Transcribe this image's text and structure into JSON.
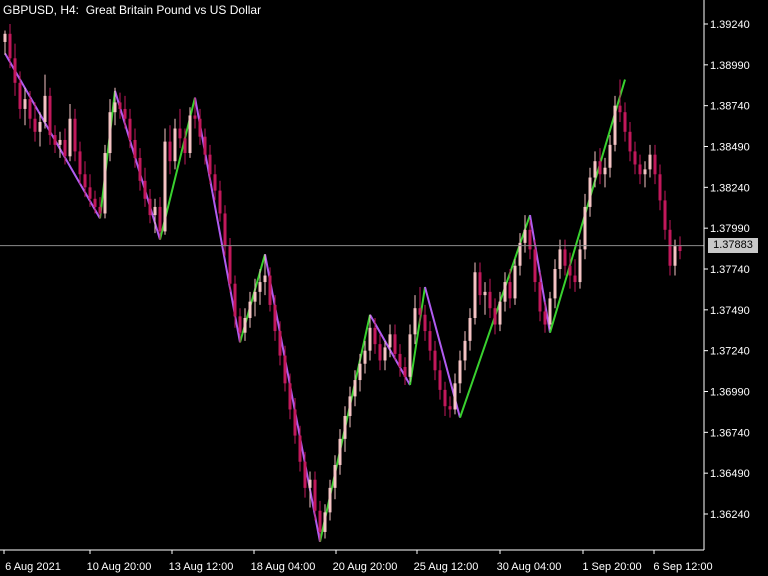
{
  "header": {
    "symbol_line": "GBPUSD, H4:  Great Britain Pound vs US Dollar"
  },
  "current_price": {
    "label": "1.37883",
    "value": 1.37883
  },
  "colors": {
    "background": "#000000",
    "bull_candle": "#f4c3c4",
    "bear_candle": "#c2185b",
    "zigzag_up": "#39d12f",
    "zigzag_down": "#b05cf0",
    "axis": "#ffffff",
    "price_line": "#8c8c8c",
    "price_tag_bg": "#c8c8c8"
  },
  "chart_data": {
    "type": "candlestick",
    "title": "GBPUSD, H4:  Great Britain Pound vs US Dollar",
    "ylim": [
      1.36,
      1.3945
    ],
    "y_ticks": [
      1.3624,
      1.3649,
      1.3674,
      1.3699,
      1.3724,
      1.3749,
      1.3774,
      1.3799,
      1.3824,
      1.3849,
      1.3874,
      1.3899,
      1.3924
    ],
    "y_tick_labels": [
      "1.36240",
      "1.36490",
      "1.36740",
      "1.36990",
      "1.37240",
      "1.37490",
      "1.37740",
      "1.37990",
      "1.38240",
      "1.38490",
      "1.38740",
      "1.38990",
      "1.39240"
    ],
    "x_tick_labels": [
      "6 Aug 2021",
      "10 Aug 20:00",
      "13 Aug 12:00",
      "18 Aug 04:00",
      "20 Aug 20:00",
      "25 Aug 12:00",
      "30 Aug 04:00",
      "1 Sep 20:00",
      "6 Sep 12:00"
    ],
    "candle_count": 138,
    "zigzag": [
      {
        "bar": 0,
        "price": 1.3906
      },
      {
        "bar": 19,
        "price": 1.3805
      },
      {
        "bar": 22,
        "price": 1.3883
      },
      {
        "bar": 31,
        "price": 1.3792
      },
      {
        "bar": 38,
        "price": 1.3879
      },
      {
        "bar": 47,
        "price": 1.3729
      },
      {
        "bar": 52,
        "price": 1.3783
      },
      {
        "bar": 63,
        "price": 1.3607
      },
      {
        "bar": 73,
        "price": 1.3746
      },
      {
        "bar": 81,
        "price": 1.3703
      },
      {
        "bar": 84,
        "price": 1.3763
      },
      {
        "bar": 91,
        "price": 1.3683
      },
      {
        "bar": 105,
        "price": 1.3807
      },
      {
        "bar": 109,
        "price": 1.3735
      },
      {
        "bar": 124,
        "price": 1.389
      }
    ],
    "candles": [
      [
        1.3913,
        1.392,
        1.3905,
        1.3918
      ],
      [
        1.3918,
        1.3924,
        1.3897,
        1.3903
      ],
      [
        1.3903,
        1.3912,
        1.388,
        1.3888
      ],
      [
        1.3888,
        1.3895,
        1.3866,
        1.3872
      ],
      [
        1.3872,
        1.3885,
        1.3862,
        1.3878
      ],
      [
        1.3878,
        1.3883,
        1.386,
        1.3866
      ],
      [
        1.3866,
        1.3876,
        1.3852,
        1.3858
      ],
      [
        1.3858,
        1.387,
        1.3849,
        1.3864
      ],
      [
        1.3864,
        1.3893,
        1.386,
        1.388
      ],
      [
        1.388,
        1.3885,
        1.385,
        1.3856
      ],
      [
        1.3856,
        1.3862,
        1.3845,
        1.385
      ],
      [
        1.385,
        1.3858,
        1.3842,
        1.3853
      ],
      [
        1.3853,
        1.386,
        1.3838,
        1.3843
      ],
      [
        1.3843,
        1.3875,
        1.384,
        1.3866
      ],
      [
        1.3866,
        1.3872,
        1.384,
        1.3846
      ],
      [
        1.3846,
        1.3852,
        1.3826,
        1.3832
      ],
      [
        1.3832,
        1.384,
        1.3818,
        1.3824
      ],
      [
        1.3824,
        1.3832,
        1.3812,
        1.3817
      ],
      [
        1.3817,
        1.3822,
        1.3808,
        1.3812
      ],
      [
        1.3812,
        1.3818,
        1.3805,
        1.3808
      ],
      [
        1.3808,
        1.385,
        1.3805,
        1.3845
      ],
      [
        1.3845,
        1.3878,
        1.384,
        1.387
      ],
      [
        1.387,
        1.3885,
        1.3862,
        1.3876
      ],
      [
        1.3876,
        1.3882,
        1.3866,
        1.3872
      ],
      [
        1.3872,
        1.388,
        1.386,
        1.3866
      ],
      [
        1.3866,
        1.3872,
        1.3848,
        1.3853
      ],
      [
        1.3853,
        1.386,
        1.3836,
        1.3842
      ],
      [
        1.3842,
        1.3848,
        1.3822,
        1.3828
      ],
      [
        1.3828,
        1.3836,
        1.3812,
        1.3817
      ],
      [
        1.3817,
        1.3823,
        1.3802,
        1.3807
      ],
      [
        1.3807,
        1.3817,
        1.3796,
        1.3812
      ],
      [
        1.3812,
        1.3818,
        1.3792,
        1.3797
      ],
      [
        1.3797,
        1.386,
        1.3795,
        1.3852
      ],
      [
        1.3852,
        1.3862,
        1.3832,
        1.384
      ],
      [
        1.384,
        1.3866,
        1.3835,
        1.386
      ],
      [
        1.386,
        1.3872,
        1.3848,
        1.3854
      ],
      [
        1.3854,
        1.386,
        1.3838,
        1.3845
      ],
      [
        1.3845,
        1.3873,
        1.3842,
        1.3868
      ],
      [
        1.3868,
        1.3879,
        1.386,
        1.3866
      ],
      [
        1.3866,
        1.3872,
        1.385,
        1.3855
      ],
      [
        1.3855,
        1.386,
        1.3838,
        1.3844
      ],
      [
        1.3844,
        1.385,
        1.3826,
        1.3832
      ],
      [
        1.3832,
        1.3838,
        1.3816,
        1.3822
      ],
      [
        1.3822,
        1.3828,
        1.3803,
        1.3808
      ],
      [
        1.3808,
        1.3813,
        1.3782,
        1.3788
      ],
      [
        1.3788,
        1.3793,
        1.376,
        1.3765
      ],
      [
        1.3765,
        1.377,
        1.3738,
        1.3745
      ],
      [
        1.3745,
        1.375,
        1.3729,
        1.3735
      ],
      [
        1.3735,
        1.375,
        1.373,
        1.3744
      ],
      [
        1.3744,
        1.376,
        1.3738,
        1.3754
      ],
      [
        1.3754,
        1.3768,
        1.3745,
        1.376
      ],
      [
        1.376,
        1.3774,
        1.3752,
        1.3766
      ],
      [
        1.3766,
        1.3783,
        1.3758,
        1.377
      ],
      [
        1.377,
        1.3775,
        1.3748,
        1.3752
      ],
      [
        1.3752,
        1.3758,
        1.373,
        1.3736
      ],
      [
        1.3736,
        1.3742,
        1.3715,
        1.3721
      ],
      [
        1.3721,
        1.3727,
        1.3699,
        1.3704
      ],
      [
        1.3704,
        1.371,
        1.3682,
        1.3688
      ],
      [
        1.3688,
        1.3695,
        1.3667,
        1.3672
      ],
      [
        1.3672,
        1.3678,
        1.365,
        1.3656
      ],
      [
        1.3656,
        1.3662,
        1.3634,
        1.364
      ],
      [
        1.364,
        1.365,
        1.3628,
        1.3645
      ],
      [
        1.3645,
        1.365,
        1.362,
        1.3626
      ],
      [
        1.3626,
        1.3632,
        1.3607,
        1.3613
      ],
      [
        1.3613,
        1.363,
        1.3609,
        1.3625
      ],
      [
        1.3625,
        1.3645,
        1.362,
        1.364
      ],
      [
        1.364,
        1.366,
        1.3633,
        1.3654
      ],
      [
        1.3654,
        1.3676,
        1.3648,
        1.367
      ],
      [
        1.367,
        1.369,
        1.3662,
        1.3684
      ],
      [
        1.3684,
        1.3702,
        1.3677,
        1.3696
      ],
      [
        1.3696,
        1.3712,
        1.369,
        1.3706
      ],
      [
        1.3706,
        1.3722,
        1.3699,
        1.3716
      ],
      [
        1.3716,
        1.373,
        1.371,
        1.3724
      ],
      [
        1.3724,
        1.3746,
        1.3718,
        1.3738
      ],
      [
        1.3738,
        1.3744,
        1.3722,
        1.3728
      ],
      [
        1.3728,
        1.3734,
        1.3712,
        1.3718
      ],
      [
        1.3718,
        1.373,
        1.3712,
        1.3726
      ],
      [
        1.3726,
        1.374,
        1.372,
        1.3734
      ],
      [
        1.3734,
        1.374,
        1.3718,
        1.3722
      ],
      [
        1.3722,
        1.3728,
        1.3708,
        1.3714
      ],
      [
        1.3714,
        1.372,
        1.3703,
        1.3708
      ],
      [
        1.3708,
        1.374,
        1.3705,
        1.3734
      ],
      [
        1.3734,
        1.3758,
        1.3728,
        1.375
      ],
      [
        1.375,
        1.3763,
        1.374,
        1.3746
      ],
      [
        1.3746,
        1.3752,
        1.373,
        1.3736
      ],
      [
        1.3736,
        1.3742,
        1.3718,
        1.3724
      ],
      [
        1.3724,
        1.373,
        1.3706,
        1.3712
      ],
      [
        1.3712,
        1.3718,
        1.3694,
        1.37
      ],
      [
        1.37,
        1.3705,
        1.3684,
        1.369
      ],
      [
        1.369,
        1.3696,
        1.3683,
        1.3688
      ],
      [
        1.3688,
        1.371,
        1.3685,
        1.3704
      ],
      [
        1.3704,
        1.3724,
        1.3698,
        1.3718
      ],
      [
        1.3718,
        1.3736,
        1.3712,
        1.373
      ],
      [
        1.373,
        1.375,
        1.3724,
        1.3744
      ],
      [
        1.3744,
        1.3778,
        1.374,
        1.3772
      ],
      [
        1.3772,
        1.3778,
        1.3752,
        1.3758
      ],
      [
        1.3758,
        1.3766,
        1.3746,
        1.376
      ],
      [
        1.376,
        1.3768,
        1.3744,
        1.375
      ],
      [
        1.375,
        1.3756,
        1.3734,
        1.374
      ],
      [
        1.374,
        1.376,
        1.3736,
        1.3754
      ],
      [
        1.3754,
        1.3772,
        1.3748,
        1.3766
      ],
      [
        1.3766,
        1.3774,
        1.375,
        1.3756
      ],
      [
        1.3756,
        1.378,
        1.3752,
        1.3776
      ],
      [
        1.3776,
        1.3796,
        1.377,
        1.379
      ],
      [
        1.379,
        1.3807,
        1.3784,
        1.3798
      ],
      [
        1.3798,
        1.3804,
        1.378,
        1.3786
      ],
      [
        1.3786,
        1.3792,
        1.376,
        1.3766
      ],
      [
        1.3766,
        1.3772,
        1.3742,
        1.3748
      ],
      [
        1.3748,
        1.3754,
        1.3735,
        1.374
      ],
      [
        1.374,
        1.376,
        1.3737,
        1.3756
      ],
      [
        1.3756,
        1.378,
        1.375,
        1.3774
      ],
      [
        1.3774,
        1.3792,
        1.3768,
        1.3786
      ],
      [
        1.3786,
        1.3792,
        1.377,
        1.3776
      ],
      [
        1.3776,
        1.3784,
        1.3762,
        1.377
      ],
      [
        1.377,
        1.378,
        1.376,
        1.3766
      ],
      [
        1.3766,
        1.3792,
        1.3762,
        1.3786
      ],
      [
        1.3786,
        1.382,
        1.378,
        1.3812
      ],
      [
        1.3812,
        1.3836,
        1.3806,
        1.383
      ],
      [
        1.383,
        1.3846,
        1.3824,
        1.384
      ],
      [
        1.384,
        1.3848,
        1.3826,
        1.3832
      ],
      [
        1.3832,
        1.3842,
        1.3824,
        1.3836
      ],
      [
        1.3836,
        1.3856,
        1.383,
        1.385
      ],
      [
        1.385,
        1.388,
        1.3846,
        1.3874
      ],
      [
        1.3874,
        1.389,
        1.3864,
        1.387
      ],
      [
        1.387,
        1.3876,
        1.3852,
        1.3858
      ],
      [
        1.3858,
        1.3864,
        1.384,
        1.3846
      ],
      [
        1.3846,
        1.3852,
        1.3832,
        1.3838
      ],
      [
        1.3838,
        1.3844,
        1.3826,
        1.3832
      ],
      [
        1.3832,
        1.384,
        1.3824,
        1.3835
      ],
      [
        1.3835,
        1.385,
        1.383,
        1.3844
      ],
      [
        1.3844,
        1.385,
        1.3826,
        1.3832
      ],
      [
        1.3832,
        1.3838,
        1.381,
        1.3816
      ],
      [
        1.3816,
        1.3822,
        1.3792,
        1.3798
      ],
      [
        1.3798,
        1.3804,
        1.377,
        1.3776
      ],
      [
        1.3776,
        1.3792,
        1.377,
        1.3788
      ],
      [
        1.3788,
        1.3794,
        1.378,
        1.3785
      ]
    ]
  }
}
